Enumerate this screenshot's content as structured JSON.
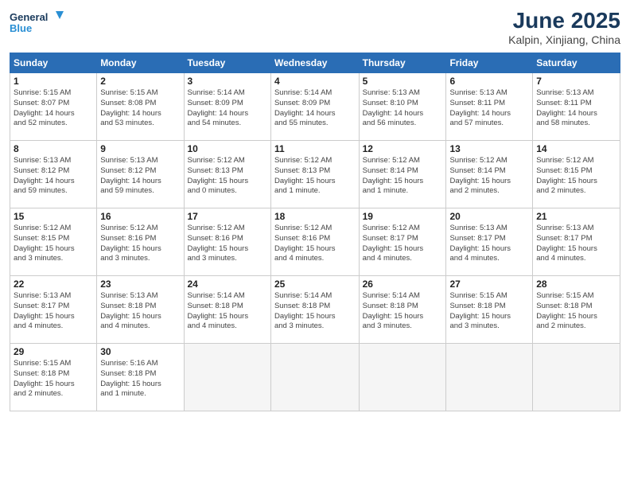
{
  "logo": {
    "line1": "General",
    "line2": "Blue"
  },
  "title": "June 2025",
  "location": "Kalpin, Xinjiang, China",
  "days_of_week": [
    "Sunday",
    "Monday",
    "Tuesday",
    "Wednesday",
    "Thursday",
    "Friday",
    "Saturday"
  ],
  "weeks": [
    [
      {
        "day": "1",
        "info": "Sunrise: 5:15 AM\nSunset: 8:07 PM\nDaylight: 14 hours\nand 52 minutes."
      },
      {
        "day": "2",
        "info": "Sunrise: 5:15 AM\nSunset: 8:08 PM\nDaylight: 14 hours\nand 53 minutes."
      },
      {
        "day": "3",
        "info": "Sunrise: 5:14 AM\nSunset: 8:09 PM\nDaylight: 14 hours\nand 54 minutes."
      },
      {
        "day": "4",
        "info": "Sunrise: 5:14 AM\nSunset: 8:09 PM\nDaylight: 14 hours\nand 55 minutes."
      },
      {
        "day": "5",
        "info": "Sunrise: 5:13 AM\nSunset: 8:10 PM\nDaylight: 14 hours\nand 56 minutes."
      },
      {
        "day": "6",
        "info": "Sunrise: 5:13 AM\nSunset: 8:11 PM\nDaylight: 14 hours\nand 57 minutes."
      },
      {
        "day": "7",
        "info": "Sunrise: 5:13 AM\nSunset: 8:11 PM\nDaylight: 14 hours\nand 58 minutes."
      }
    ],
    [
      {
        "day": "8",
        "info": "Sunrise: 5:13 AM\nSunset: 8:12 PM\nDaylight: 14 hours\nand 59 minutes."
      },
      {
        "day": "9",
        "info": "Sunrise: 5:13 AM\nSunset: 8:12 PM\nDaylight: 14 hours\nand 59 minutes."
      },
      {
        "day": "10",
        "info": "Sunrise: 5:12 AM\nSunset: 8:13 PM\nDaylight: 15 hours\nand 0 minutes."
      },
      {
        "day": "11",
        "info": "Sunrise: 5:12 AM\nSunset: 8:13 PM\nDaylight: 15 hours\nand 1 minute."
      },
      {
        "day": "12",
        "info": "Sunrise: 5:12 AM\nSunset: 8:14 PM\nDaylight: 15 hours\nand 1 minute."
      },
      {
        "day": "13",
        "info": "Sunrise: 5:12 AM\nSunset: 8:14 PM\nDaylight: 15 hours\nand 2 minutes."
      },
      {
        "day": "14",
        "info": "Sunrise: 5:12 AM\nSunset: 8:15 PM\nDaylight: 15 hours\nand 2 minutes."
      }
    ],
    [
      {
        "day": "15",
        "info": "Sunrise: 5:12 AM\nSunset: 8:15 PM\nDaylight: 15 hours\nand 3 minutes."
      },
      {
        "day": "16",
        "info": "Sunrise: 5:12 AM\nSunset: 8:16 PM\nDaylight: 15 hours\nand 3 minutes."
      },
      {
        "day": "17",
        "info": "Sunrise: 5:12 AM\nSunset: 8:16 PM\nDaylight: 15 hours\nand 3 minutes."
      },
      {
        "day": "18",
        "info": "Sunrise: 5:12 AM\nSunset: 8:16 PM\nDaylight: 15 hours\nand 4 minutes."
      },
      {
        "day": "19",
        "info": "Sunrise: 5:12 AM\nSunset: 8:17 PM\nDaylight: 15 hours\nand 4 minutes."
      },
      {
        "day": "20",
        "info": "Sunrise: 5:13 AM\nSunset: 8:17 PM\nDaylight: 15 hours\nand 4 minutes."
      },
      {
        "day": "21",
        "info": "Sunrise: 5:13 AM\nSunset: 8:17 PM\nDaylight: 15 hours\nand 4 minutes."
      }
    ],
    [
      {
        "day": "22",
        "info": "Sunrise: 5:13 AM\nSunset: 8:17 PM\nDaylight: 15 hours\nand 4 minutes."
      },
      {
        "day": "23",
        "info": "Sunrise: 5:13 AM\nSunset: 8:18 PM\nDaylight: 15 hours\nand 4 minutes."
      },
      {
        "day": "24",
        "info": "Sunrise: 5:14 AM\nSunset: 8:18 PM\nDaylight: 15 hours\nand 4 minutes."
      },
      {
        "day": "25",
        "info": "Sunrise: 5:14 AM\nSunset: 8:18 PM\nDaylight: 15 hours\nand 3 minutes."
      },
      {
        "day": "26",
        "info": "Sunrise: 5:14 AM\nSunset: 8:18 PM\nDaylight: 15 hours\nand 3 minutes."
      },
      {
        "day": "27",
        "info": "Sunrise: 5:15 AM\nSunset: 8:18 PM\nDaylight: 15 hours\nand 3 minutes."
      },
      {
        "day": "28",
        "info": "Sunrise: 5:15 AM\nSunset: 8:18 PM\nDaylight: 15 hours\nand 2 minutes."
      }
    ],
    [
      {
        "day": "29",
        "info": "Sunrise: 5:15 AM\nSunset: 8:18 PM\nDaylight: 15 hours\nand 2 minutes."
      },
      {
        "day": "30",
        "info": "Sunrise: 5:16 AM\nSunset: 8:18 PM\nDaylight: 15 hours\nand 1 minute."
      },
      {
        "day": "",
        "info": ""
      },
      {
        "day": "",
        "info": ""
      },
      {
        "day": "",
        "info": ""
      },
      {
        "day": "",
        "info": ""
      },
      {
        "day": "",
        "info": ""
      }
    ]
  ]
}
